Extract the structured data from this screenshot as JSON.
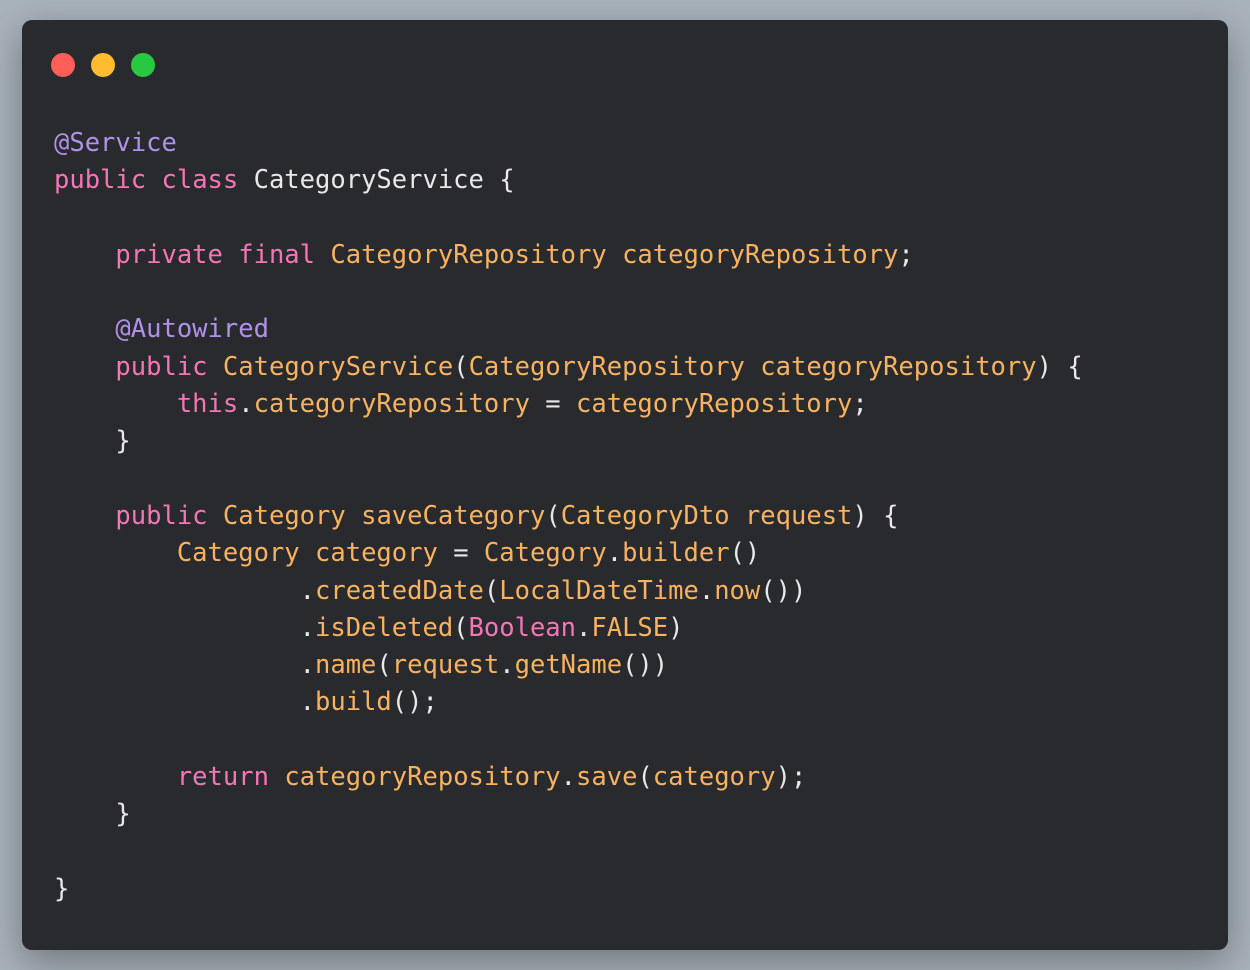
{
  "window": {
    "buttons": [
      {
        "name": "close",
        "color": "#ff5f57"
      },
      {
        "name": "minimize",
        "color": "#febc2e"
      },
      {
        "name": "zoom",
        "color": "#28c840"
      }
    ]
  },
  "colors": {
    "background": "#282a2e",
    "annotation": "#b191e8",
    "keyword": "#f575b6",
    "type": "#f8b260",
    "plain": "#e8e8e8"
  },
  "code": {
    "language": "java",
    "lines": [
      [
        {
          "t": "annotation",
          "v": "@Service"
        }
      ],
      [
        {
          "t": "keyword",
          "v": "public"
        },
        {
          "t": "plain",
          "v": " "
        },
        {
          "t": "keyword",
          "v": "class"
        },
        {
          "t": "plain",
          "v": " CategoryService {"
        }
      ],
      [],
      [
        {
          "t": "plain",
          "v": "    "
        },
        {
          "t": "keyword",
          "v": "private"
        },
        {
          "t": "plain",
          "v": " "
        },
        {
          "t": "keyword",
          "v": "final"
        },
        {
          "t": "plain",
          "v": " "
        },
        {
          "t": "type",
          "v": "CategoryRepository"
        },
        {
          "t": "plain",
          "v": " "
        },
        {
          "t": "ident",
          "v": "categoryRepository"
        },
        {
          "t": "plain",
          "v": ";"
        }
      ],
      [],
      [
        {
          "t": "plain",
          "v": "    "
        },
        {
          "t": "annotation",
          "v": "@Autowired"
        }
      ],
      [
        {
          "t": "plain",
          "v": "    "
        },
        {
          "t": "keyword",
          "v": "public"
        },
        {
          "t": "plain",
          "v": " "
        },
        {
          "t": "method",
          "v": "CategoryService"
        },
        {
          "t": "plain",
          "v": "("
        },
        {
          "t": "type",
          "v": "CategoryRepository"
        },
        {
          "t": "plain",
          "v": " "
        },
        {
          "t": "ident",
          "v": "categoryRepository"
        },
        {
          "t": "plain",
          "v": ") {"
        }
      ],
      [
        {
          "t": "plain",
          "v": "        "
        },
        {
          "t": "keyword",
          "v": "this"
        },
        {
          "t": "plain",
          "v": "."
        },
        {
          "t": "ident",
          "v": "categoryRepository"
        },
        {
          "t": "plain",
          "v": " = "
        },
        {
          "t": "ident",
          "v": "categoryRepository"
        },
        {
          "t": "plain",
          "v": ";"
        }
      ],
      [
        {
          "t": "plain",
          "v": "    }"
        }
      ],
      [],
      [
        {
          "t": "plain",
          "v": "    "
        },
        {
          "t": "keyword",
          "v": "public"
        },
        {
          "t": "plain",
          "v": " "
        },
        {
          "t": "type",
          "v": "Category"
        },
        {
          "t": "plain",
          "v": " "
        },
        {
          "t": "method",
          "v": "saveCategory"
        },
        {
          "t": "plain",
          "v": "("
        },
        {
          "t": "type",
          "v": "CategoryDto"
        },
        {
          "t": "plain",
          "v": " "
        },
        {
          "t": "ident",
          "v": "request"
        },
        {
          "t": "plain",
          "v": ") {"
        }
      ],
      [
        {
          "t": "plain",
          "v": "        "
        },
        {
          "t": "type",
          "v": "Category"
        },
        {
          "t": "plain",
          "v": " "
        },
        {
          "t": "ident",
          "v": "category"
        },
        {
          "t": "plain",
          "v": " = "
        },
        {
          "t": "type",
          "v": "Category"
        },
        {
          "t": "plain",
          "v": "."
        },
        {
          "t": "method",
          "v": "builder"
        },
        {
          "t": "plain",
          "v": "()"
        }
      ],
      [
        {
          "t": "plain",
          "v": "                ."
        },
        {
          "t": "method",
          "v": "createdDate"
        },
        {
          "t": "plain",
          "v": "("
        },
        {
          "t": "type",
          "v": "LocalDateTime"
        },
        {
          "t": "plain",
          "v": "."
        },
        {
          "t": "method",
          "v": "now"
        },
        {
          "t": "plain",
          "v": "())"
        }
      ],
      [
        {
          "t": "plain",
          "v": "                ."
        },
        {
          "t": "method",
          "v": "isDeleted"
        },
        {
          "t": "plain",
          "v": "("
        },
        {
          "t": "keyword",
          "v": "Boolean"
        },
        {
          "t": "plain",
          "v": "."
        },
        {
          "t": "ident",
          "v": "FALSE"
        },
        {
          "t": "plain",
          "v": ")"
        }
      ],
      [
        {
          "t": "plain",
          "v": "                ."
        },
        {
          "t": "method",
          "v": "name"
        },
        {
          "t": "plain",
          "v": "("
        },
        {
          "t": "ident",
          "v": "request"
        },
        {
          "t": "plain",
          "v": "."
        },
        {
          "t": "method",
          "v": "getName"
        },
        {
          "t": "plain",
          "v": "())"
        }
      ],
      [
        {
          "t": "plain",
          "v": "                ."
        },
        {
          "t": "method",
          "v": "build"
        },
        {
          "t": "plain",
          "v": "();"
        }
      ],
      [],
      [
        {
          "t": "plain",
          "v": "        "
        },
        {
          "t": "keyword",
          "v": "return"
        },
        {
          "t": "plain",
          "v": " "
        },
        {
          "t": "ident",
          "v": "categoryRepository"
        },
        {
          "t": "plain",
          "v": "."
        },
        {
          "t": "method",
          "v": "save"
        },
        {
          "t": "plain",
          "v": "("
        },
        {
          "t": "ident",
          "v": "category"
        },
        {
          "t": "plain",
          "v": ");"
        }
      ],
      [
        {
          "t": "plain",
          "v": "    }"
        }
      ],
      [],
      [
        {
          "t": "plain",
          "v": "}"
        }
      ]
    ]
  }
}
